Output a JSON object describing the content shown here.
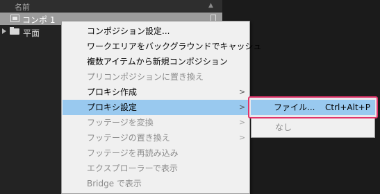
{
  "panel": {
    "column_header": "名前",
    "rows": [
      {
        "label": "コンポ 1",
        "icon": "composition-icon"
      },
      {
        "label": "平面",
        "icon": "folder-icon"
      }
    ]
  },
  "context_menu": {
    "items": [
      {
        "label": "コンポジション設定...",
        "enabled": true,
        "submenu": false
      },
      {
        "label": "ワークエリアをバックグラウンドでキャッシュ",
        "enabled": true,
        "submenu": false
      },
      {
        "label": "複数アイテムから新規コンポジション",
        "enabled": true,
        "submenu": false
      },
      {
        "label": "プリコンポジションに置き換え",
        "enabled": false,
        "submenu": false
      },
      {
        "label": "プロキシ作成",
        "enabled": true,
        "submenu": true
      },
      {
        "label": "プロキシ設定",
        "enabled": true,
        "submenu": true,
        "highlighted": true
      },
      {
        "label": "フッテージを変換",
        "enabled": false,
        "submenu": true
      },
      {
        "label": "フッテージの置き換え",
        "enabled": false,
        "submenu": true
      },
      {
        "label": "フッテージを再読み込み",
        "enabled": false,
        "submenu": false
      },
      {
        "label": "エクスプローラーで表示",
        "enabled": false,
        "submenu": false
      },
      {
        "label": "Bridge で表示",
        "enabled": false,
        "submenu": false
      }
    ],
    "submenu_arrow": ">"
  },
  "proxy_submenu": {
    "items": [
      {
        "label": "ファイル...",
        "shortcut": "Ctrl+Alt+P",
        "enabled": true,
        "highlighted": true
      },
      {
        "label": "なし",
        "shortcut": "",
        "enabled": false
      }
    ]
  },
  "colors": {
    "highlight": "#99c9ef",
    "annotation_outline": "#e0336a",
    "selected_row": "#9c9c9c"
  }
}
